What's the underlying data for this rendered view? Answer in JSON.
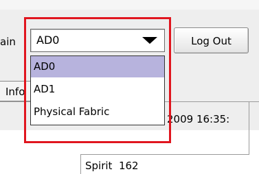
{
  "header": {
    "domain_label_partial": "ain"
  },
  "domain_selector": {
    "selected_value": "AD0",
    "options": [
      "AD0",
      "AD1",
      "Physical Fabric"
    ],
    "highlighted_index": 0
  },
  "toolbar": {
    "logout_label": "Log Out"
  },
  "tabs": {
    "info_label_partial": "Info"
  },
  "panel": {
    "timestamp_partial": "2009 16:35:",
    "cell_text": "Spirit  162"
  },
  "colors": {
    "highlight_border": "#e0151e",
    "selected_item_bg": "#b7b3dd"
  }
}
